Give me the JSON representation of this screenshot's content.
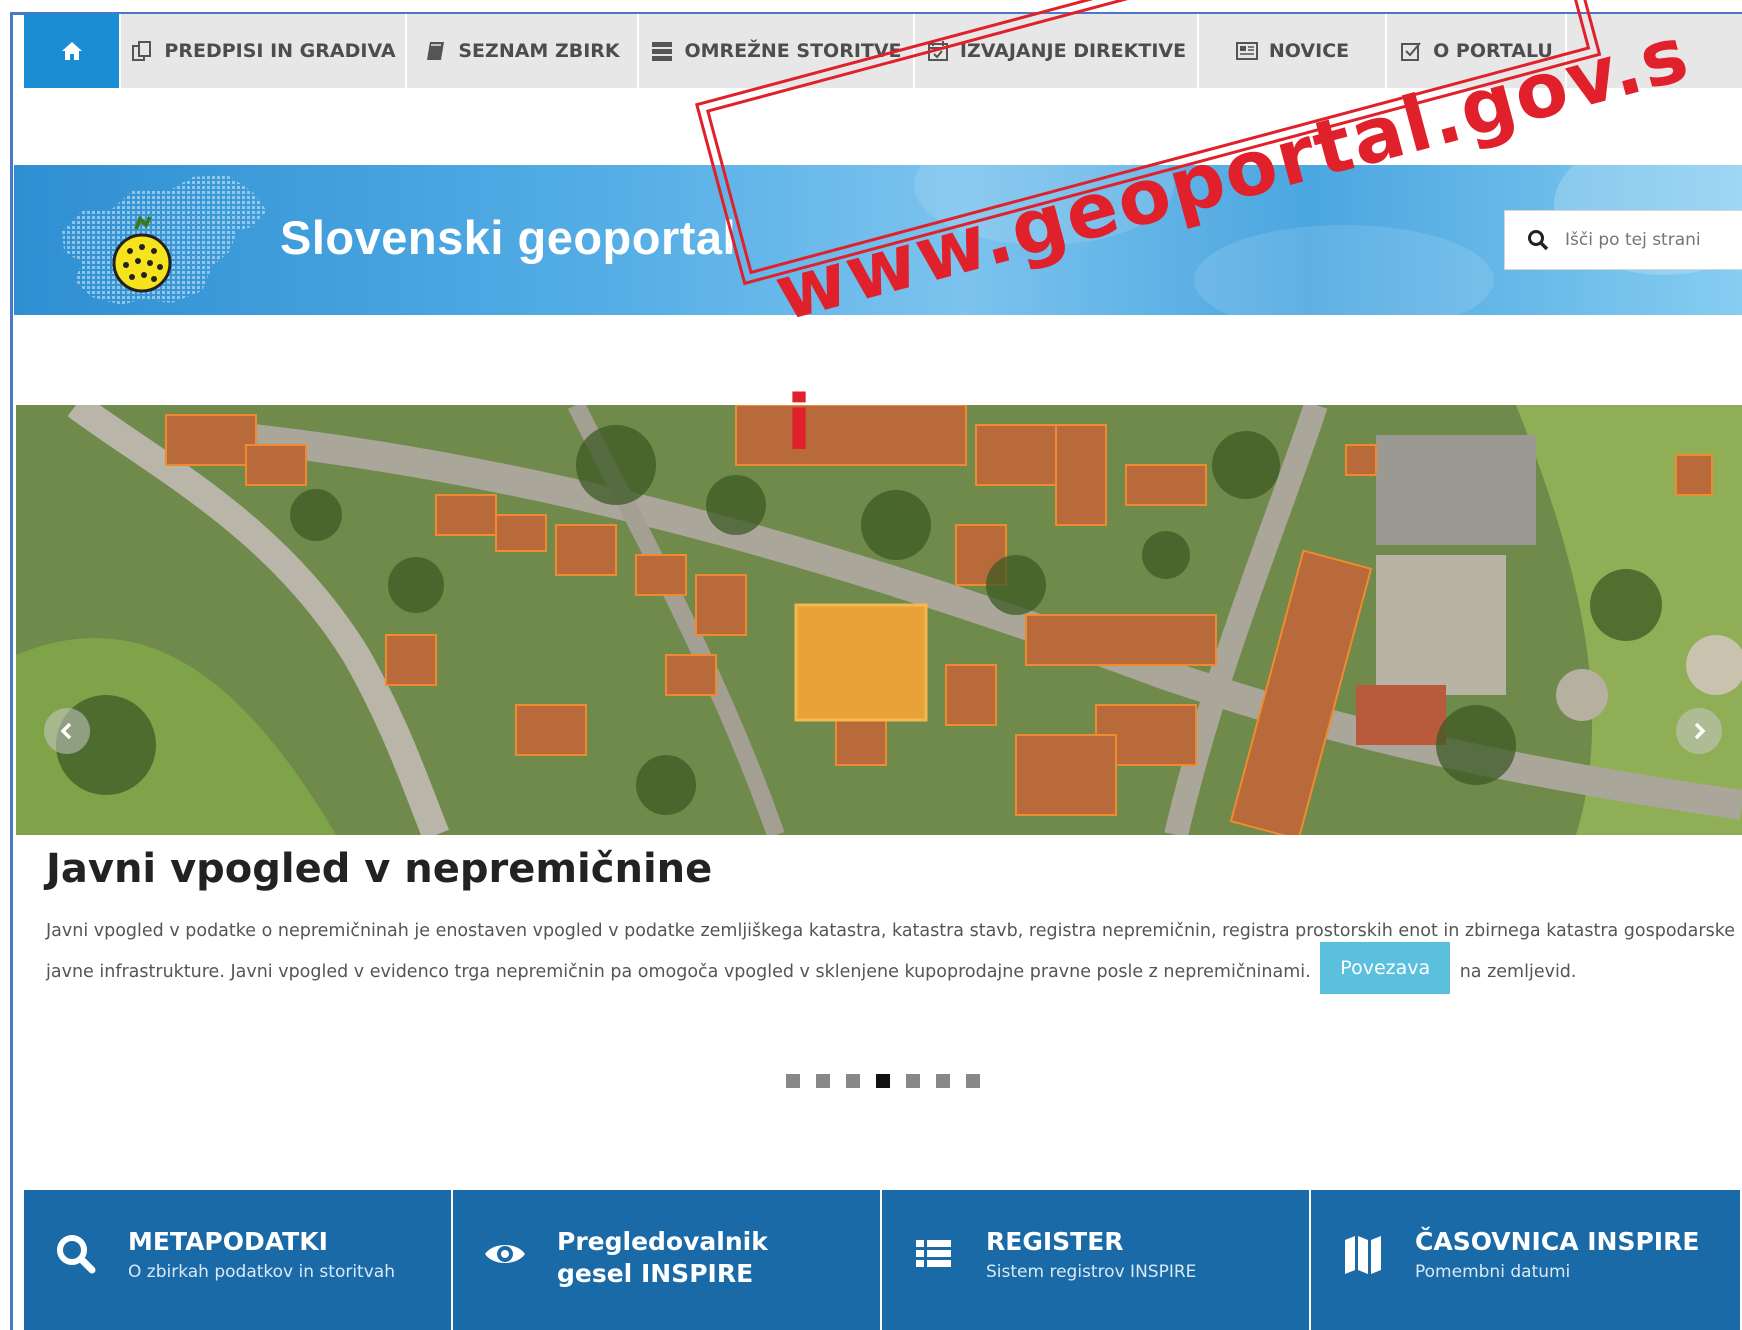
{
  "nav": {
    "items": [
      {
        "label": "PREDPISI IN GRADIVA",
        "icon": "documents-icon"
      },
      {
        "label": "SEZNAM ZBIRK",
        "icon": "book-icon"
      },
      {
        "label": "OMREŽNE STORITVE",
        "icon": "server-icon"
      },
      {
        "label": "IZVAJANJE DIREKTIVE",
        "icon": "calendar-check-icon"
      },
      {
        "label": "NOVICE",
        "icon": "newspaper-icon"
      },
      {
        "label": "O PORTALU",
        "icon": "checkbox-icon"
      }
    ],
    "home_icon": "home-icon",
    "home_color": "#1b8ed3"
  },
  "header": {
    "title": "Slovenski geoportal",
    "search_placeholder": "Išči po tej strani"
  },
  "slide": {
    "heading": "Javni vpogled v nepremičnine",
    "text_part1": "Javni vpogled v podatke o nepremičninah je enostaven vpogled v podatke zemljiškega katastra, katastra stavb, registra nepremičnin, registra prostorskih enot in zbirnega katastra gospodarske javne infrastrukture. Javni vpogled v evidenco trga nepremičnin pa omogoča vpogled v sklenjene kupoprodajne pravne posle z nepremičninami.",
    "button_label": "Povezava",
    "text_part2": "na zemljevid.",
    "dot_count": 7,
    "active_dot": 4
  },
  "tiles": [
    {
      "title": "METAPODATKI",
      "subtitle": "O zbirkah podatkov in storitvah",
      "icon": "search-icon"
    },
    {
      "title": "Pregledovalnik gesel INSPIRE",
      "subtitle": "",
      "icon": "eye-icon"
    },
    {
      "title": "REGISTER",
      "subtitle": "Sistem registrov INSPIRE",
      "icon": "list-icon"
    },
    {
      "title": "ČASOVNICA INSPIRE",
      "subtitle": "Pomembni datumi",
      "icon": "map-icon"
    }
  ],
  "watermark": {
    "text": "www.geoportal.gov.s",
    "text_tail": "i",
    "color": "#e0202a"
  },
  "colors": {
    "tile_bg": "#1a6aa8",
    "button_bg": "#5bc0de"
  }
}
